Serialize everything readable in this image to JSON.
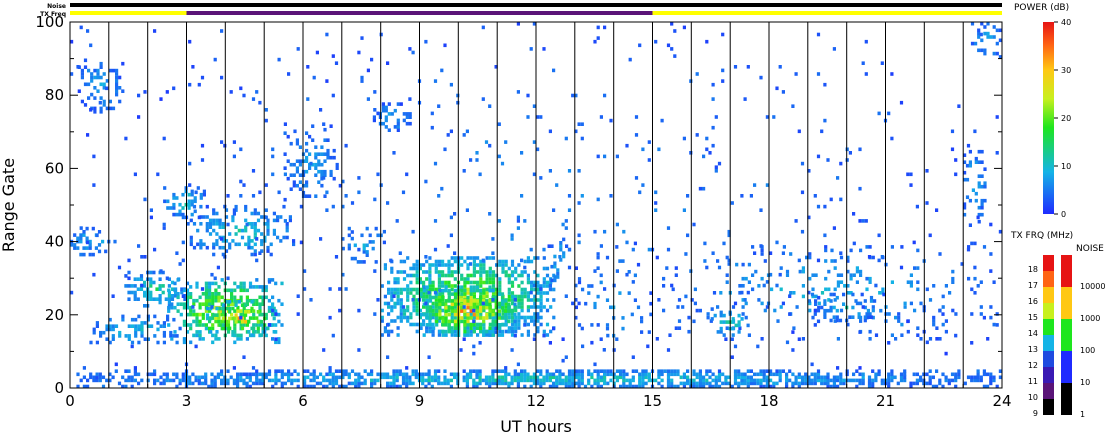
{
  "chart_data": {
    "type": "heatmap",
    "xlabel": "UT hours",
    "ylabel": "Range Gate",
    "xlim": [
      0,
      24
    ],
    "ylim": [
      0,
      100
    ],
    "x_ticks": [
      "0",
      "3",
      "6",
      "9",
      "12",
      "15",
      "18",
      "21",
      "24"
    ],
    "y_ticks": [
      "0",
      "20",
      "40",
      "60",
      "80",
      "100"
    ],
    "noise_label": "Noise",
    "txfreq_label": "TX Freq",
    "txfreq_segments": [
      {
        "start": 0,
        "end": 3.0,
        "color": "#ffff00"
      },
      {
        "start": 3.0,
        "end": 15.0,
        "color": "#5a1478"
      },
      {
        "start": 15.0,
        "end": 24,
        "color": "#ffff00"
      }
    ],
    "scan_boundaries": [
      1,
      2,
      3,
      4,
      5,
      6,
      7,
      8,
      9,
      10,
      11,
      12,
      13,
      14,
      15,
      16,
      17,
      18,
      19,
      20,
      21,
      22,
      23
    ],
    "power_colorbar": {
      "title": "POWER (dB)",
      "ticks": [
        "0",
        "10",
        "20",
        "30",
        "40"
      ],
      "min": 0,
      "max": 40
    },
    "freq_colorbar": {
      "title": "TX FRQ (MHz)",
      "ticks": [
        "9",
        "10",
        "11",
        "12",
        "13",
        "14",
        "15",
        "16",
        "17",
        "18"
      ],
      "colors": [
        "#000000",
        "#5a1478",
        "#3a1ab4",
        "#1f4be0",
        "#14b4e6",
        "#1ee61e",
        "#c8f01e",
        "#ffc814",
        "#ff6414",
        "#e61414"
      ]
    },
    "noise_colorbar": {
      "title": "NOISE",
      "ticks": [
        "1",
        "10",
        "100",
        "1000",
        "10000"
      ],
      "colors": [
        "#000000",
        "#1f2bff",
        "#1ee61e",
        "#ffc814",
        "#e61414"
      ]
    },
    "regions": [
      {
        "x0": 0.0,
        "x1": 24.0,
        "y0": 0,
        "y1": 5,
        "pmax": 12,
        "density": 0.85
      },
      {
        "x0": 0.2,
        "x1": 1.4,
        "y0": 75,
        "y1": 90,
        "pmax": 8,
        "density": 0.35
      },
      {
        "x0": 0.0,
        "x1": 1.2,
        "y0": 36,
        "y1": 44,
        "pmax": 10,
        "density": 0.4
      },
      {
        "x0": 0.5,
        "x1": 2.8,
        "y0": 12,
        "y1": 20,
        "pmax": 11,
        "density": 0.5
      },
      {
        "x0": 1.4,
        "x1": 3.0,
        "y0": 22,
        "y1": 32,
        "pmax": 15,
        "density": 0.55
      },
      {
        "x0": 2.5,
        "x1": 5.5,
        "y0": 12,
        "y1": 30,
        "pmax": 30,
        "density": 0.7
      },
      {
        "x0": 3.5,
        "x1": 5.3,
        "y0": 14,
        "y1": 24,
        "pmax": 36,
        "density": 0.55
      },
      {
        "x0": 3.0,
        "x1": 5.8,
        "y0": 36,
        "y1": 50,
        "pmax": 12,
        "density": 0.45
      },
      {
        "x0": 5.5,
        "x1": 7.0,
        "y0": 50,
        "y1": 72,
        "pmax": 8,
        "density": 0.35
      },
      {
        "x0": 2.4,
        "x1": 3.5,
        "y0": 46,
        "y1": 56,
        "pmax": 12,
        "density": 0.45
      },
      {
        "x0": 7.8,
        "x1": 8.8,
        "y0": 70,
        "y1": 78,
        "pmax": 8,
        "density": 0.45
      },
      {
        "x0": 7.0,
        "x1": 8.0,
        "y0": 34,
        "y1": 44,
        "pmax": 9,
        "density": 0.3
      },
      {
        "x0": 8.0,
        "x1": 12.5,
        "y0": 14,
        "y1": 36,
        "pmax": 26,
        "density": 0.85
      },
      {
        "x0": 9.0,
        "x1": 11.5,
        "y0": 14,
        "y1": 28,
        "pmax": 38,
        "density": 0.8
      },
      {
        "x0": 12.3,
        "x1": 12.9,
        "y0": 28,
        "y1": 42,
        "pmax": 10,
        "density": 0.35
      },
      {
        "x0": 13.0,
        "x1": 15.0,
        "y0": 8,
        "y1": 40,
        "pmax": 8,
        "density": 0.12
      },
      {
        "x0": 15.0,
        "x1": 24.0,
        "y0": 12,
        "y1": 40,
        "pmax": 9,
        "density": 0.12
      },
      {
        "x0": 16.5,
        "x1": 17.5,
        "y0": 14,
        "y1": 22,
        "pmax": 15,
        "density": 0.5
      },
      {
        "x0": 19.0,
        "x1": 21.0,
        "y0": 18,
        "y1": 26,
        "pmax": 10,
        "density": 0.35
      },
      {
        "x0": 23.0,
        "x1": 23.6,
        "y0": 44,
        "y1": 66,
        "pmax": 10,
        "density": 0.35
      },
      {
        "x0": 23.2,
        "x1": 24.0,
        "y0": 90,
        "y1": 100,
        "pmax": 10,
        "density": 0.4
      },
      {
        "x0": 0.0,
        "x1": 24.0,
        "y0": 5,
        "y1": 100,
        "pmax": 5,
        "density": 0.035
      }
    ]
  }
}
